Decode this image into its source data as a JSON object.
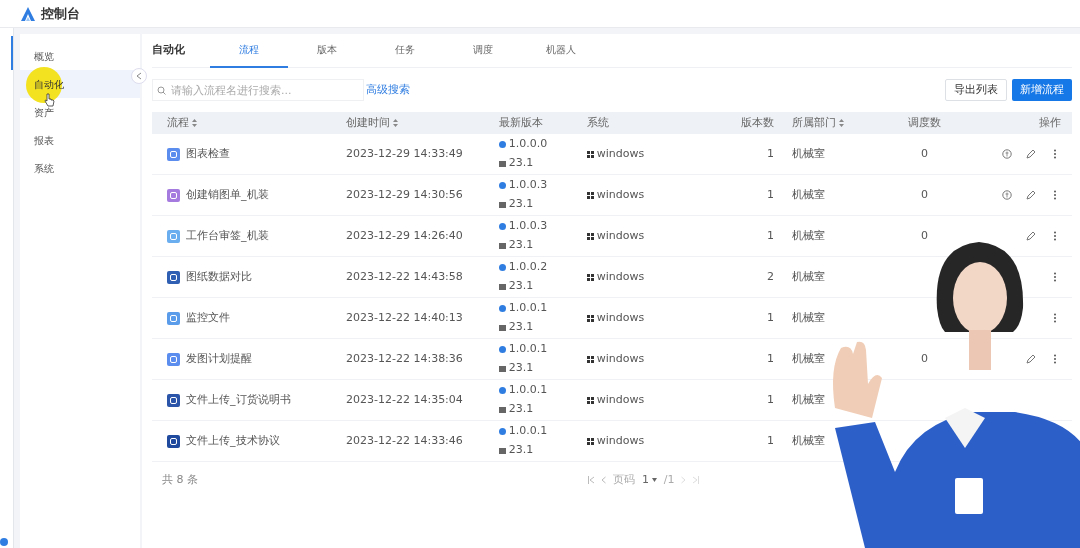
{
  "app": {
    "title": "控制台"
  },
  "sidebar": {
    "items": [
      {
        "label": "概览",
        "selected": false
      },
      {
        "label": "自动化",
        "selected": true
      },
      {
        "label": "资产",
        "selected": false
      },
      {
        "label": "报表",
        "selected": false
      },
      {
        "label": "系统",
        "selected": false
      }
    ]
  },
  "section_title": "自动化",
  "tabs": [
    {
      "label": "流程",
      "selected": true
    },
    {
      "label": "版本",
      "selected": false
    },
    {
      "label": "任务",
      "selected": false
    },
    {
      "label": "调度",
      "selected": false
    },
    {
      "label": "机器人",
      "selected": false
    }
  ],
  "search": {
    "placeholder": "请输入流程名进行搜索...",
    "advanced_link": "高级搜索"
  },
  "buttons": [
    {
      "label": "导出列表",
      "kind": "outline"
    },
    {
      "label": "新增流程",
      "kind": "primary"
    }
  ],
  "table": {
    "columns": [
      {
        "label": "流程",
        "sortable": true
      },
      {
        "label": "创建时间",
        "sortable": true
      },
      {
        "label": "最新版本",
        "sortable": false
      },
      {
        "label": "系统",
        "sortable": false
      },
      {
        "label": "版本数",
        "sortable": false
      },
      {
        "label": "所属部门",
        "sortable": true
      },
      {
        "label": "调度数",
        "sortable": false
      },
      {
        "label": "操作",
        "sortable": false
      }
    ],
    "rows": [
      {
        "name": "图表检查",
        "color": "#5b8def",
        "created": "2023-12-29 14:33:49",
        "version": "1.0.0.0",
        "build": "23.1",
        "system": "windows",
        "versions": "1",
        "dept": "机械室",
        "schedules": "0",
        "actions": [
          {
            "kind": "run"
          },
          {
            "kind": "edit"
          },
          {
            "kind": "more"
          }
        ]
      },
      {
        "name": "创建销图单_机装",
        "color": "#a67be0",
        "created": "2023-12-29 14:30:56",
        "version": "1.0.0.3",
        "build": "23.1",
        "system": "windows",
        "versions": "1",
        "dept": "机械室",
        "schedules": "0",
        "actions": [
          {
            "kind": "run"
          },
          {
            "kind": "edit"
          },
          {
            "kind": "more"
          }
        ]
      },
      {
        "name": "工作台审签_机装",
        "color": "#6aaef0",
        "created": "2023-12-29 14:26:40",
        "version": "1.0.0.3",
        "build": "23.1",
        "system": "windows",
        "versions": "1",
        "dept": "机械室",
        "schedules": "0",
        "actions": [
          {
            "kind": "edit"
          },
          {
            "kind": "more"
          }
        ]
      },
      {
        "name": "图纸数据对比",
        "color": "#2f5fb3",
        "created": "2023-12-22 14:43:58",
        "version": "1.0.0.2",
        "build": "23.1",
        "system": "windows",
        "versions": "2",
        "dept": "机械室",
        "actions": [
          {
            "kind": "more"
          }
        ]
      },
      {
        "name": "监控文件",
        "color": "#5b9cea",
        "created": "2023-12-22 14:40:13",
        "version": "1.0.0.1",
        "build": "23.1",
        "system": "windows",
        "versions": "1",
        "dept": "机械室",
        "actions": [
          {
            "kind": "more"
          }
        ]
      },
      {
        "name": "发图计划提醒",
        "color": "#5b8def",
        "created": "2023-12-22 14:38:36",
        "version": "1.0.0.1",
        "build": "23.1",
        "system": "windows",
        "versions": "1",
        "dept": "机械室",
        "schedules": "0",
        "actions": [
          {
            "kind": "edit"
          },
          {
            "kind": "more"
          }
        ]
      },
      {
        "name": "文件上传_订货说明书",
        "color": "#2b55a8",
        "created": "2023-12-22 14:35:04",
        "version": "1.0.0.1",
        "build": "23.1",
        "system": "windows",
        "versions": "1",
        "dept": "机械室"
      },
      {
        "name": "文件上传_技术协议",
        "color": "#1f4a9e",
        "created": "2023-12-22 14:33:46",
        "version": "1.0.0.1",
        "build": "23.1",
        "system": "windows",
        "versions": "1",
        "dept": "机械室"
      }
    ]
  },
  "footer": {
    "total": "共 8 条",
    "page_label": "页码",
    "page": "1",
    "page_total": "/1"
  }
}
